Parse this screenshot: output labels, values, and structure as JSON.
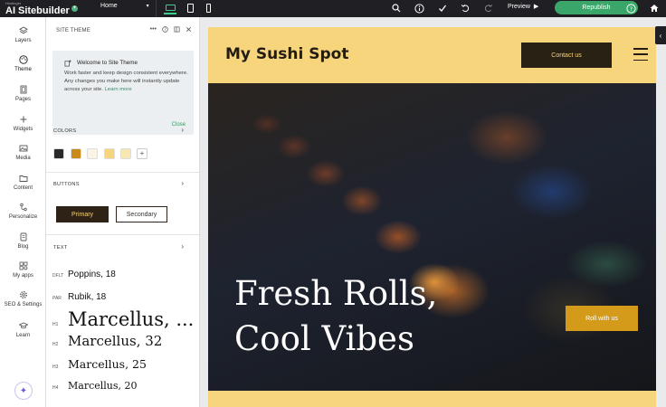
{
  "topbar": {
    "brand_small": "Hostinger",
    "brand_ai": "AI",
    "brand_name": "Sitebuilder",
    "page_select": "Home",
    "page_select_icon": "chevron-down-icon",
    "preview_label": "Preview",
    "republish_label": "Republish",
    "republish_color": "#3aa66a"
  },
  "leftnav": {
    "items": [
      {
        "label": "Layers",
        "icon": "layers-icon"
      },
      {
        "label": "Theme",
        "icon": "palette-icon"
      },
      {
        "label": "Pages",
        "icon": "pages-icon"
      },
      {
        "label": "Widgets",
        "icon": "plus-icon"
      },
      {
        "label": "Media",
        "icon": "media-icon"
      },
      {
        "label": "Content",
        "icon": "folder-icon"
      },
      {
        "label": "Personalize",
        "icon": "personalize-icon"
      },
      {
        "label": "Blog",
        "icon": "blog-icon"
      },
      {
        "label": "My apps",
        "icon": "apps-icon"
      },
      {
        "label": "SEO & Settings",
        "icon": "gear-icon"
      },
      {
        "label": "Learn",
        "icon": "learn-icon"
      }
    ]
  },
  "panel": {
    "title": "SITE THEME",
    "welcome": {
      "title": "Welcome to Site Theme",
      "body": "Work faster and keep design consistent everywhere. Any changes you make here will instantly update across your site.",
      "learn_more": "Learn more",
      "close": "Close"
    },
    "colors_label": "COLORS",
    "swatches": [
      "#2a2a2a",
      "#c98a1a",
      "#fbf3e4",
      "#f7d57c",
      "#f7e7b0"
    ],
    "buttons_label": "BUTTONS",
    "primary_label": "Primary",
    "secondary_label": "Secondary",
    "text_label": "TEXT",
    "text_styles": [
      {
        "tag": "DFLT",
        "value": "Poppins, 18"
      },
      {
        "tag": "PAR",
        "value": "Rubik, 18"
      },
      {
        "tag": "H1",
        "value": "Marcellus, ..."
      },
      {
        "tag": "H2",
        "value": "Marcellus, 32"
      },
      {
        "tag": "H3",
        "value": "Marcellus, 25"
      },
      {
        "tag": "H4",
        "value": "Marcellus, 20"
      }
    ]
  },
  "site": {
    "logo": "My Sushi Spot",
    "contact_label": "Contact us",
    "hero_line1": "Fresh Rolls,",
    "hero_line2": "Cool Vibes",
    "hero_button": "Roll with us",
    "brand_color": "#f7d57c",
    "dark_color": "#2a2115",
    "accent_color": "#d49a1a"
  }
}
